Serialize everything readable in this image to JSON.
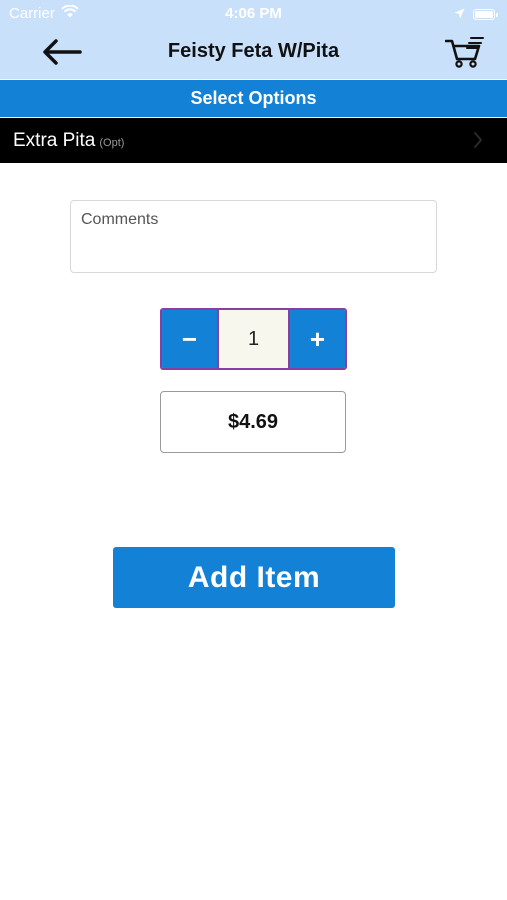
{
  "status_bar": {
    "carrier": "Carrier",
    "time": "4:06 PM",
    "battery_level_percent": 100
  },
  "nav": {
    "title": "Feisty Feta W/Pita",
    "back_icon": "arrow-left-icon",
    "cart_icon": "shopping-cart-icon"
  },
  "options_header": {
    "label": "Select Options"
  },
  "options": [
    {
      "label": "Extra Pita",
      "tag": "(Opt)"
    }
  ],
  "comments": {
    "placeholder": "Comments",
    "value": ""
  },
  "quantity": {
    "decrement_label": "−",
    "value": "1",
    "increment_label": "+"
  },
  "price": "$4.69",
  "add_button": {
    "label": "Add Item"
  },
  "colors": {
    "header_bg": "#c9e0fb",
    "accent_blue": "#1281d6",
    "option_row_bg": "#000000",
    "stepper_border": "#8a3fa0"
  }
}
